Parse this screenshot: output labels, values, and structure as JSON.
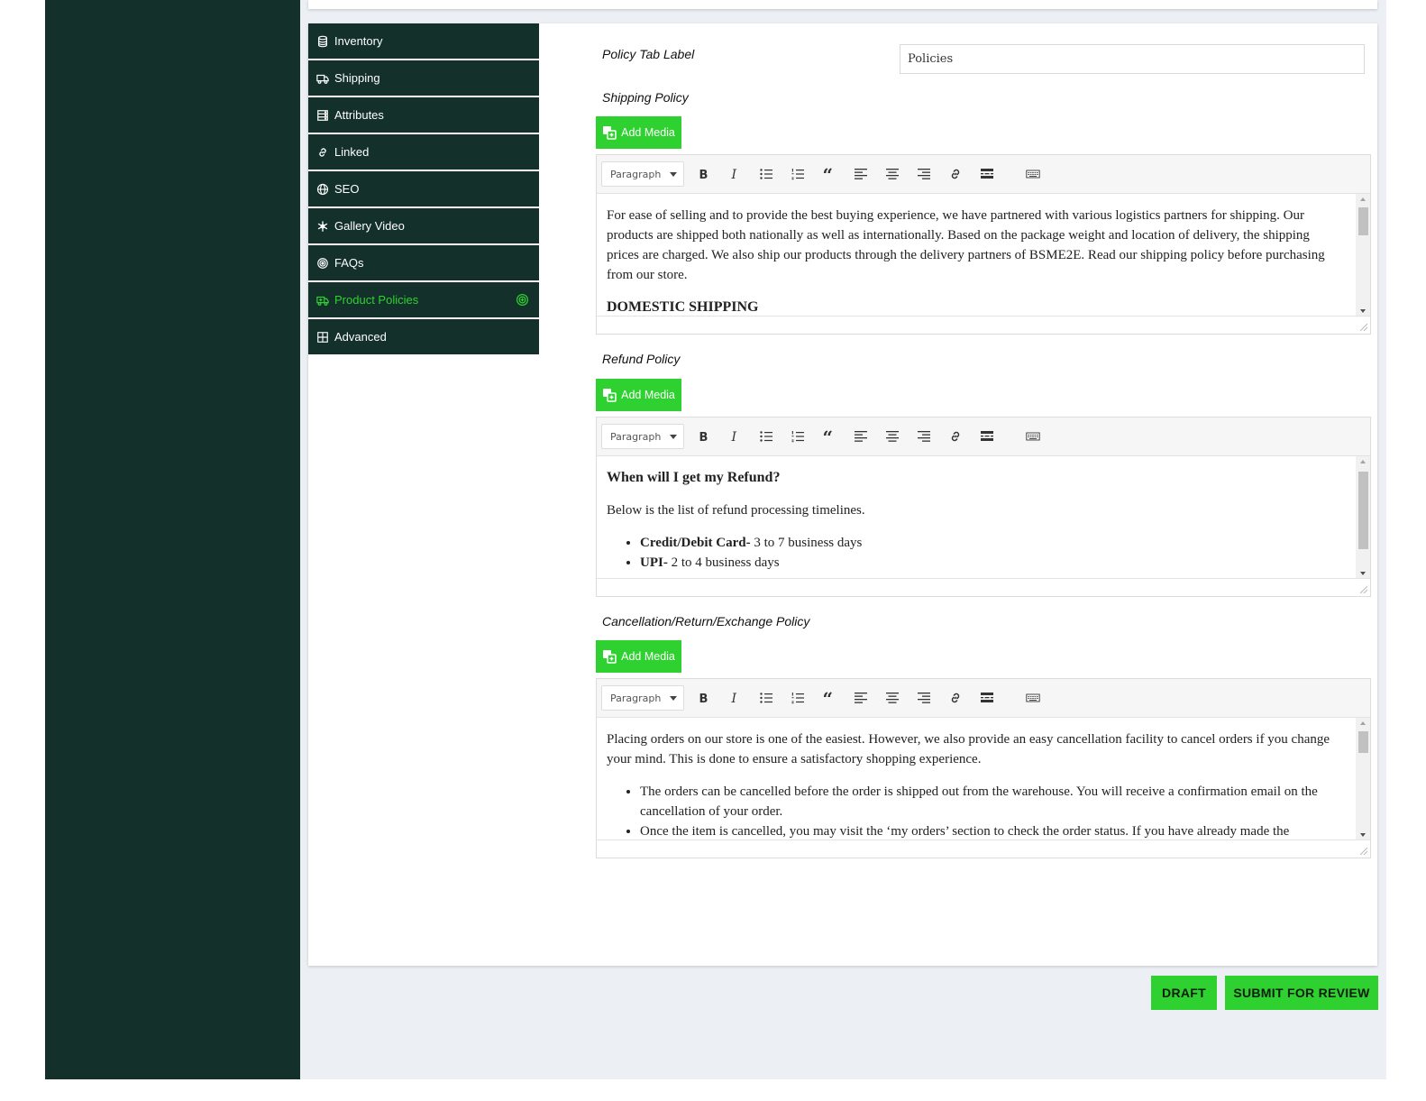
{
  "tabs": [
    {
      "label": "Inventory",
      "icon": "database-icon"
    },
    {
      "label": "Shipping",
      "icon": "truck-icon"
    },
    {
      "label": "Attributes",
      "icon": "server-icon"
    },
    {
      "label": "Linked",
      "icon": "link-icon"
    },
    {
      "label": "SEO",
      "icon": "globe-icon"
    },
    {
      "label": "Gallery Video",
      "icon": "snowflake-icon"
    },
    {
      "label": "FAQs",
      "icon": "target-icon"
    },
    {
      "label": "Product Policies",
      "icon": "ambulance-icon",
      "active": true,
      "end_icon": "plus-circle-icon"
    },
    {
      "label": "Advanced",
      "icon": "grid-icon"
    }
  ],
  "colors": {
    "sidebar": "#13302a",
    "accent": "#2fd130",
    "background": "#eceff3"
  },
  "form": {
    "policy_tab_label": {
      "label": "Policy Tab Label",
      "value": "Policies"
    },
    "add_media_label": "Add Media",
    "format_select_value": "Paragraph",
    "shipping": {
      "label": "Shipping Policy",
      "paragraph": "For ease of selling and to provide the best buying experience, we have partnered with various logistics partners for shipping. Our products are shipped both nationally as well as internationally. Based on the package weight and location of delivery, the shipping prices are charged. We also ship our products through the delivery partners of BSME2E. Read our shipping policy before purchasing from our store.",
      "heading": "DOMESTIC SHIPPING"
    },
    "refund": {
      "label": "Refund Policy",
      "heading": "When will I get my Refund?",
      "paragraph": "Below is the list of refund processing timelines.",
      "items": [
        {
          "bold": "Credit/Debit Card-",
          "text": " 3 to 7 business days"
        },
        {
          "bold": "UPI-",
          "text": " 2 to 4 business days"
        }
      ]
    },
    "cancellation": {
      "label": "Cancellation/Return/Exchange Policy",
      "paragraph": "Placing orders on our store is one of the easiest. However, we also provide an easy cancellation facility to cancel orders if you change your mind. This is done to ensure a satisfactory shopping experience.",
      "items": [
        "The orders can be cancelled before the order is shipped out from the warehouse. You will receive a confirmation email on the cancellation of your order.",
        "Once the item is cancelled, you may visit the ‘my orders’ section to check the order status. If you have already made the"
      ]
    }
  },
  "toolbar_buttons": [
    "bold-icon",
    "italic-icon",
    "bullet-list-icon",
    "numbered-list-icon",
    "blockquote-icon",
    "align-left-icon",
    "align-center-icon",
    "align-right-icon",
    "link-icon",
    "read-more-icon",
    "toolbar-toggle-icon"
  ],
  "actions": {
    "draft_label": "DRAFT",
    "submit_label": "SUBMIT FOR REVIEW"
  }
}
